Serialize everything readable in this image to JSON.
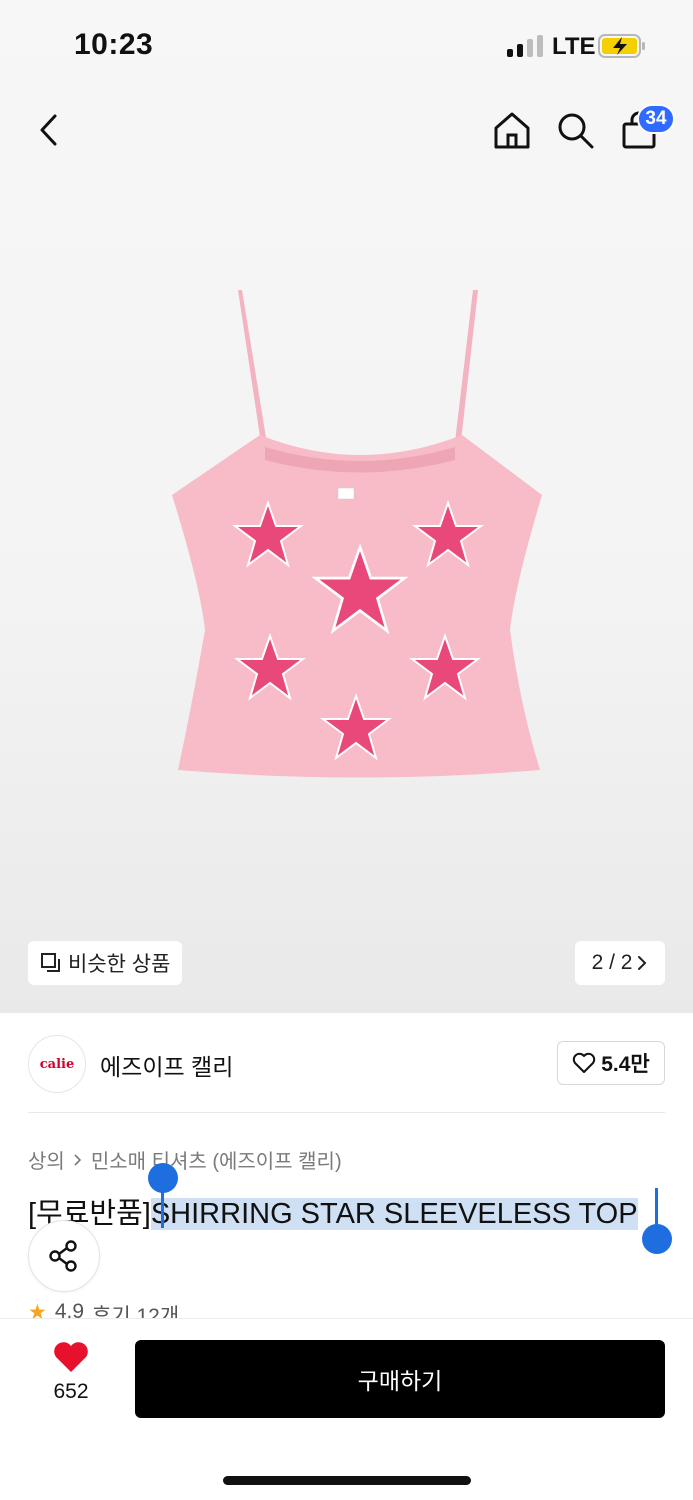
{
  "status": {
    "time": "10:23",
    "network": "LTE"
  },
  "nav": {
    "cart_count": "34"
  },
  "hero": {
    "similar_label": "비슷한 상품",
    "page_indicator": "2 / 2"
  },
  "brand": {
    "logo_text": "calie",
    "name": "에즈이프 캘리",
    "like_count": "5.4만"
  },
  "breadcrumb": {
    "category": "상의",
    "subcategory": "민소매 티셔츠 (에즈이프 캘리)"
  },
  "product": {
    "title_prefix": "[무료반품]",
    "title_main": "SHIRRING STAR SLEEVELESS TOP",
    "rating": "4.9",
    "reviews": "후기 12개"
  },
  "bottom": {
    "likes": "652",
    "buy_label": "구매하기"
  },
  "colors": {
    "accent_blue": "#2f6bff",
    "heart_red": "#e8112d",
    "star_pink": "#e84b7d",
    "top_pink": "#f6b8c4"
  }
}
